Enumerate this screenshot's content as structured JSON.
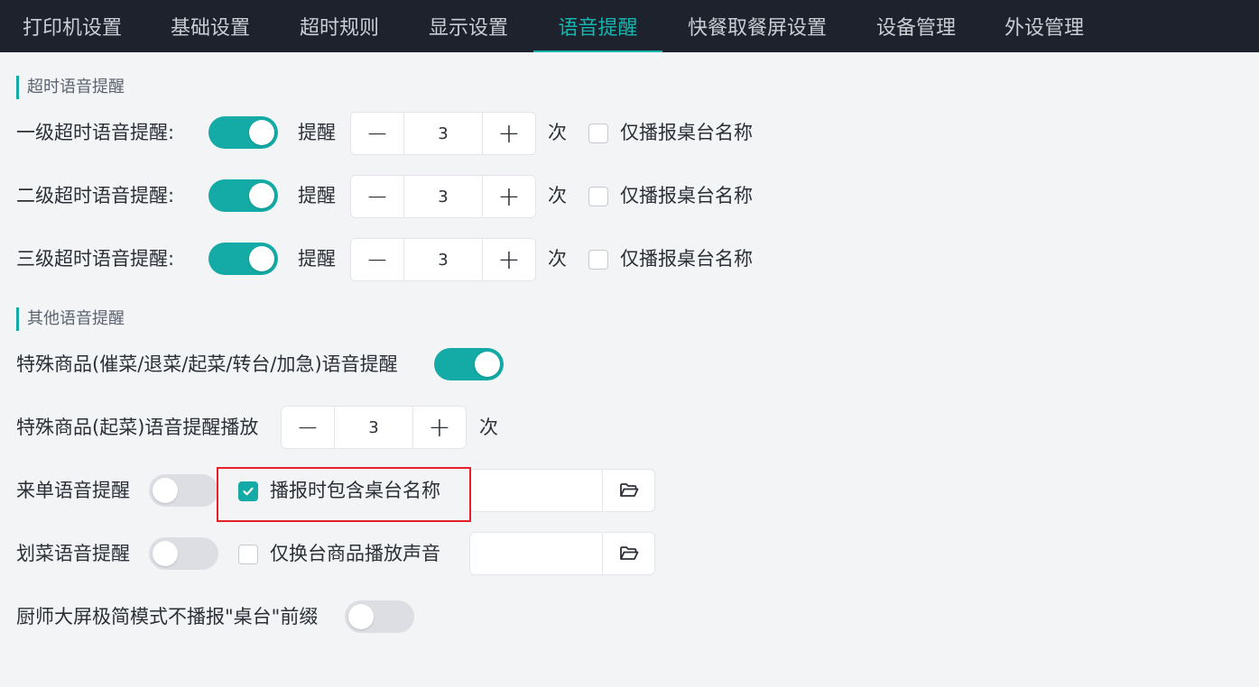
{
  "tabs": [
    {
      "label": "打印机设置"
    },
    {
      "label": "基础设置"
    },
    {
      "label": "超时规则"
    },
    {
      "label": "显示设置"
    },
    {
      "label": "语音提醒",
      "active": true
    },
    {
      "label": "快餐取餐屏设置"
    },
    {
      "label": "设备管理"
    },
    {
      "label": "外设管理"
    }
  ],
  "timeout_section": {
    "title": "超时语音提醒",
    "rows": [
      {
        "label": "一级超时语音提醒:",
        "enabled": true,
        "remind_label": "提醒",
        "count": "3",
        "unit": "次",
        "table_only_label": "仅播报桌台名称",
        "table_only": false
      },
      {
        "label": "二级超时语音提醒:",
        "enabled": true,
        "remind_label": "提醒",
        "count": "3",
        "unit": "次",
        "table_only_label": "仅播报桌台名称",
        "table_only": false
      },
      {
        "label": "三级超时语音提醒:",
        "enabled": true,
        "remind_label": "提醒",
        "count": "3",
        "unit": "次",
        "table_only_label": "仅播报桌台名称",
        "table_only": false
      }
    ]
  },
  "other_section": {
    "title": "其他语音提醒",
    "special_goods": {
      "label": "特殊商品(催菜/退菜/起菜/转台/加急)语音提醒",
      "enabled": true
    },
    "special_start": {
      "label": "特殊商品(起菜)语音提醒播放",
      "count": "3",
      "unit": "次"
    },
    "new_order": {
      "label": "来单语音提醒",
      "enabled": false,
      "include_table_label": "播报时包含桌台名称",
      "include_table": true
    },
    "dish_mark": {
      "label": "划菜语音提醒",
      "enabled": false,
      "transfer_only_label": "仅换台商品播放声音",
      "transfer_only": false
    },
    "chef_screen": {
      "label": "厨师大屏极简模式不播报\"桌台\"前缀",
      "enabled": false
    }
  },
  "stepper": {
    "minus": "−",
    "plus": "+"
  },
  "colors": {
    "accent": "#14aaa5",
    "tabbar": "#1d222c",
    "highlight": "#e5202a"
  }
}
